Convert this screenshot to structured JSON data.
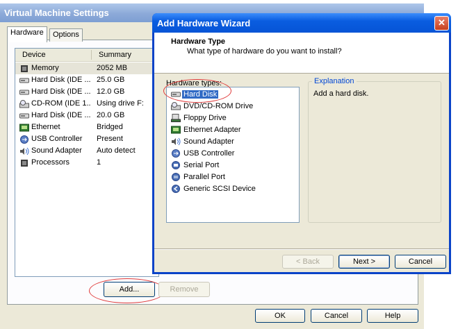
{
  "settings_window": {
    "title": "Virtual Machine Settings",
    "tabs": [
      "Hardware",
      "Options"
    ],
    "columns": {
      "device": "Device",
      "summary": "Summary"
    },
    "devices": [
      {
        "icon": "memory-icon",
        "name": "Memory",
        "summary": "2052 MB"
      },
      {
        "icon": "hard-disk-icon",
        "name": "Hard Disk (IDE ...",
        "summary": "25.0 GB"
      },
      {
        "icon": "hard-disk-icon",
        "name": "Hard Disk (IDE ...",
        "summary": "12.0 GB"
      },
      {
        "icon": "cdrom-icon",
        "name": "CD-ROM (IDE 1...",
        "summary": "Using drive F:"
      },
      {
        "icon": "hard-disk-icon",
        "name": "Hard Disk (IDE ...",
        "summary": "20.0 GB"
      },
      {
        "icon": "ethernet-icon",
        "name": "Ethernet",
        "summary": "Bridged"
      },
      {
        "icon": "usb-icon",
        "name": "USB Controller",
        "summary": "Present"
      },
      {
        "icon": "sound-icon",
        "name": "Sound Adapter",
        "summary": "Auto detect"
      },
      {
        "icon": "processor-icon",
        "name": "Processors",
        "summary": "1"
      }
    ],
    "buttons": {
      "add": "Add...",
      "remove": "Remove",
      "ok": "OK",
      "cancel": "Cancel",
      "help": "Help"
    }
  },
  "wizard": {
    "title": "Add Hardware Wizard",
    "close_glyph": "✕",
    "heading": "Hardware Type",
    "subheading": "What type of hardware do you want to install?",
    "hardware_types_label": "Hardware types:",
    "hardware_types": [
      {
        "icon": "hard-disk-icon",
        "name": "Hard Disk",
        "selected": true
      },
      {
        "icon": "dvd-drive-icon",
        "name": "DVD/CD-ROM Drive"
      },
      {
        "icon": "floppy-drive-icon",
        "name": "Floppy Drive"
      },
      {
        "icon": "ethernet-adapter-icon",
        "name": "Ethernet Adapter"
      },
      {
        "icon": "sound-adapter-icon",
        "name": "Sound Adapter"
      },
      {
        "icon": "usb-controller-icon",
        "name": "USB Controller"
      },
      {
        "icon": "serial-port-icon",
        "name": "Serial Port"
      },
      {
        "icon": "parallel-port-icon",
        "name": "Parallel Port"
      },
      {
        "icon": "scsi-device-icon",
        "name": "Generic SCSI Device"
      }
    ],
    "explanation_label": "Explanation",
    "explanation_text": "Add a hard disk.",
    "buttons": {
      "back": "< Back",
      "next": "Next >",
      "cancel": "Cancel"
    }
  },
  "colors": {
    "annotation": "#e03a3a",
    "selection": "#316ac5",
    "wizard_title": "#0a5de0"
  }
}
